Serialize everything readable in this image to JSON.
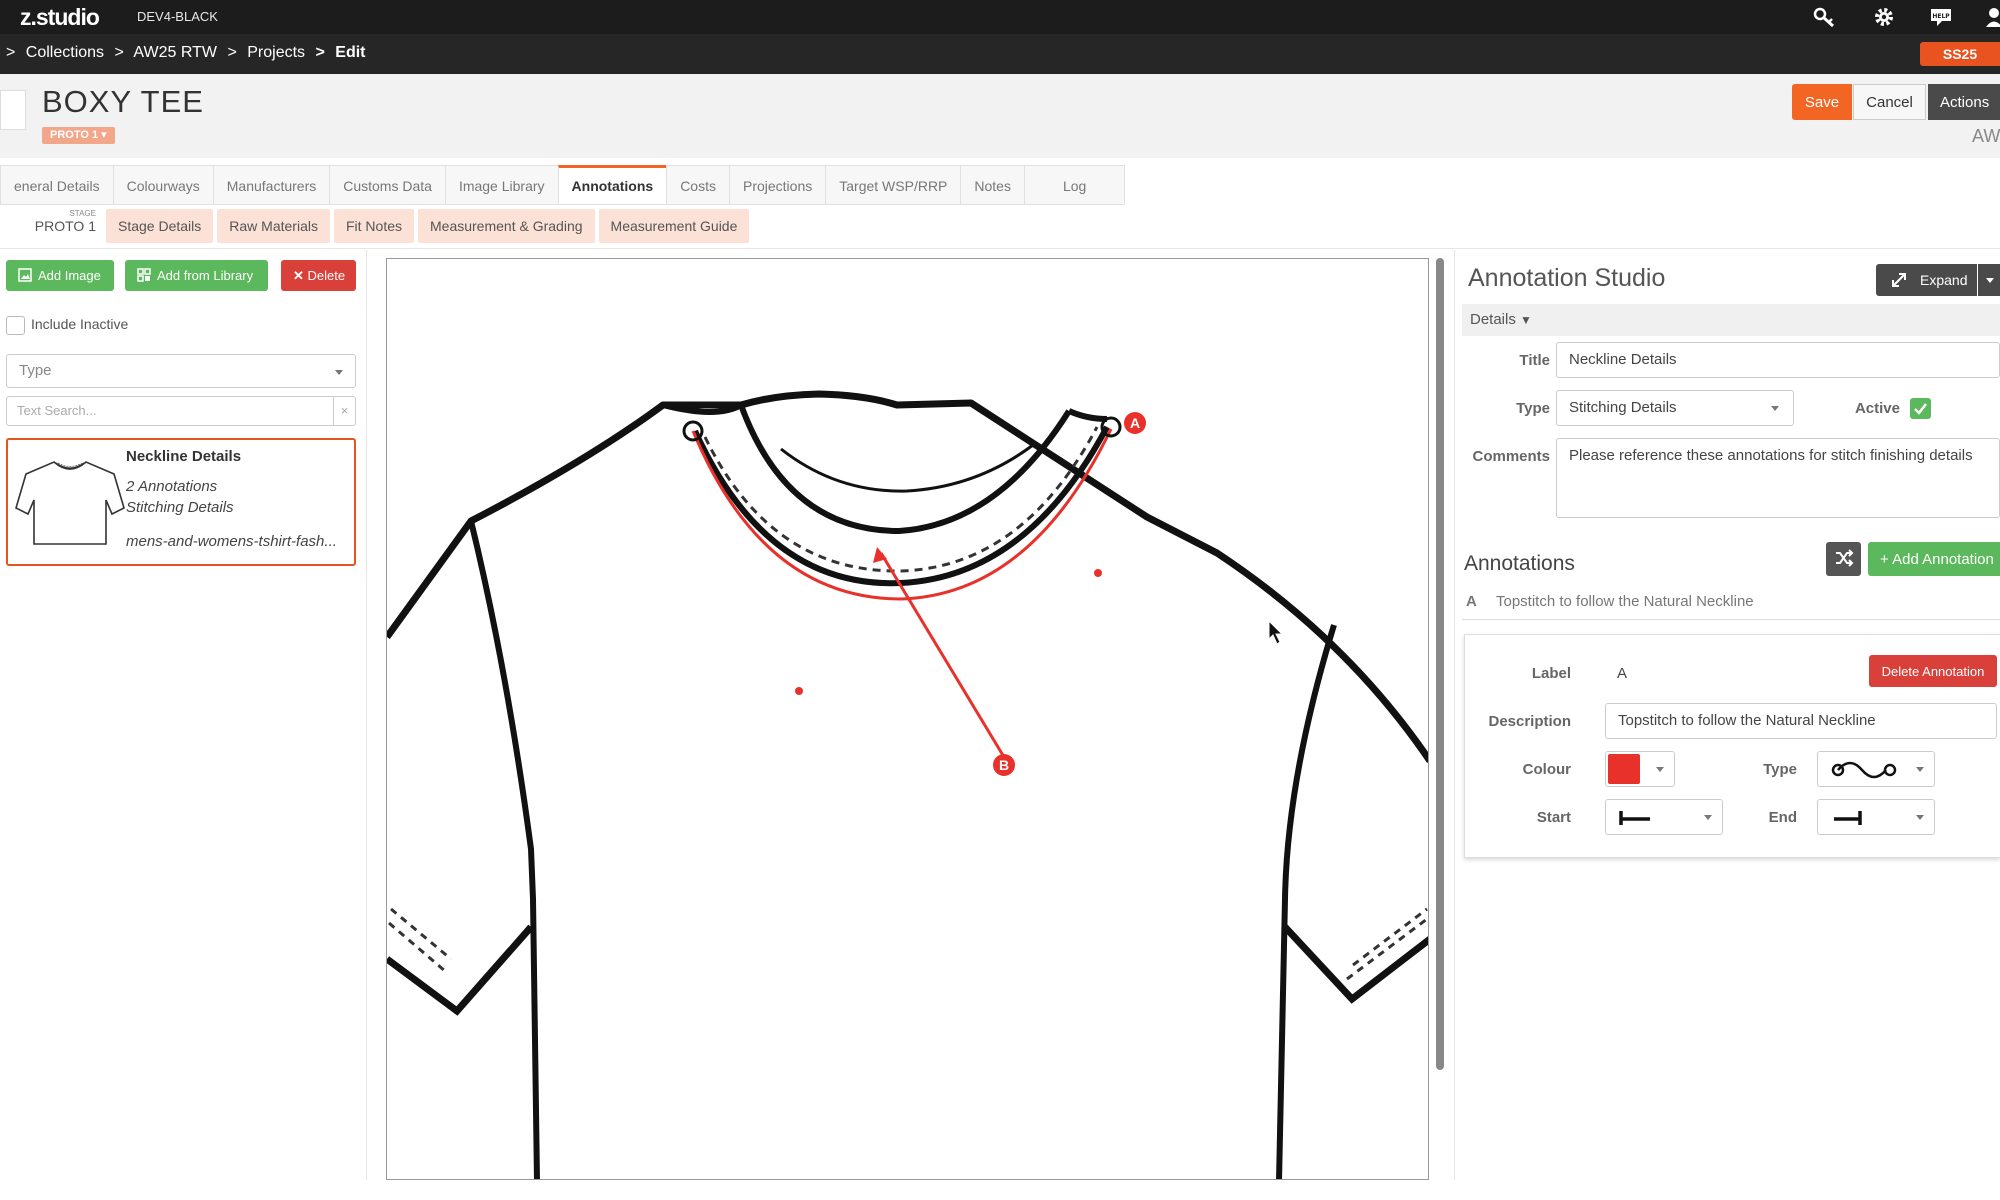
{
  "topbar": {
    "logo": "z.studio",
    "environment": "DEV4-BLACK",
    "icons": [
      "key-icon",
      "gear-icon",
      "help-icon",
      "user-icon"
    ]
  },
  "breadcrumb": {
    "items": [
      ">",
      "Collections",
      ">",
      "AW25 RTW",
      ">",
      "Projects",
      ">",
      "Edit"
    ],
    "season": "SS25"
  },
  "header": {
    "title": "BOXY TEE",
    "proto_badge": "PROTO 1",
    "save": "Save",
    "cancel": "Cancel",
    "actions": "Actions",
    "season_short": "AW"
  },
  "tabs": [
    "eneral Details",
    "Colourways",
    "Manufacturers",
    "Customs Data",
    "Image Library",
    "Annotations",
    "Costs",
    "Projections",
    "Target WSP/RRP",
    "Notes",
    "Log"
  ],
  "active_tab": "Annotations",
  "stage": {
    "label": "STAGE",
    "value": "PROTO 1"
  },
  "subtabs": [
    "Stage Details",
    "Raw Materials",
    "Fit Notes",
    "Measurement & Grading",
    "Measurement Guide"
  ],
  "left": {
    "add_image": "Add Image",
    "add_from_library": "Add from Library",
    "delete": "Delete",
    "include_inactive": "Include Inactive",
    "type_placeholder": "Type",
    "search_placeholder": "Text Search...",
    "clear": "×",
    "card": {
      "title": "Neckline Details",
      "annotations": "2 Annotations",
      "type": "Stitching Details",
      "filename": "mens-and-womens-tshirt-fash..."
    }
  },
  "canvas": {
    "label_a": "A",
    "label_b": "B",
    "annotation_color": "#e8312a"
  },
  "studio": {
    "title": "Annotation Studio",
    "expand": "Expand",
    "details": "Details",
    "title_label": "Title",
    "title_value": "Neckline Details",
    "type_label": "Type",
    "type_value": "Stitching Details",
    "active_label": "Active",
    "comments_label": "Comments",
    "comments_value": "Please reference these annotations for stitch finishing details",
    "annotations_heading": "Annotations",
    "add_annotation": "+ Add Annotation",
    "annotation_letter": "A",
    "annotation_text": "Topstitch to follow the Natural Neckline",
    "panel": {
      "label_label": "Label",
      "label_value": "A",
      "delete_annotation": "Delete Annotation",
      "description_label": "Description",
      "description_value": "Topstitch to follow the Natural Neckline",
      "colour_label": "Colour",
      "colour_value": "#e8312a",
      "type_label": "Type",
      "start_label": "Start",
      "end_label": "End"
    }
  }
}
